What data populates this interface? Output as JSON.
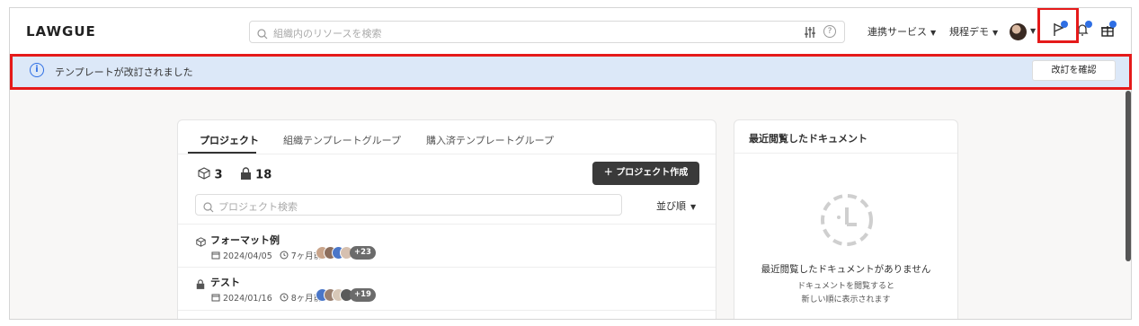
{
  "header": {
    "logo": "LAWGUE",
    "search_placeholder": "組織内のリソースを検索",
    "help_label": "?",
    "nav_integrations": "連携サービス",
    "nav_workspace": "規程デモ"
  },
  "banner": {
    "info_glyph": "i",
    "message": "テンプレートが改訂されました",
    "button": "改訂を確認"
  },
  "projects": {
    "tabs": [
      {
        "label": "プロジェクト",
        "active": true
      },
      {
        "label": "組織テンプレートグループ",
        "active": false
      },
      {
        "label": "購入済テンプレートグループ",
        "active": false
      }
    ],
    "count_public": "3",
    "count_private": "18",
    "create_button": "＋ プロジェクト作成",
    "search_placeholder": "プロジェクト検索",
    "sort_label": "並び順",
    "items": [
      {
        "name": "フォーマット例",
        "date": "2024/04/05",
        "ago": "7ヶ月前",
        "extra_members": "+23",
        "kind": "box-icon"
      },
      {
        "name": "テスト",
        "date": "2024/01/16",
        "ago": "8ヶ月前",
        "extra_members": "+19",
        "kind": "lock-icon"
      }
    ]
  },
  "recent": {
    "title": "最近閲覧したドキュメント",
    "empty_title": "最近閲覧したドキュメントがありません",
    "empty_desc_1": "ドキュメントを閲覧すると",
    "empty_desc_2": "新しい順に表示されます"
  },
  "colors": {
    "accent": "#2f6fe4",
    "banner_bg": "#dce8f8",
    "highlight": "#e51a1a",
    "primary_button": "#3a3a3a"
  }
}
